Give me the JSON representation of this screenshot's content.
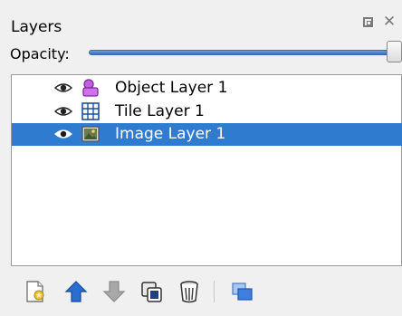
{
  "panel": {
    "title": "Layers"
  },
  "opacity": {
    "label": "Opacity:",
    "value": 1.0
  },
  "layers": [
    {
      "name": "Object Layer 1",
      "type": "object-layer-icon",
      "visible": true,
      "selected": false
    },
    {
      "name": "Tile Layer 1",
      "type": "tile-layer-icon",
      "visible": true,
      "selected": false
    },
    {
      "name": "Image Layer 1",
      "type": "image-layer-icon",
      "visible": true,
      "selected": true
    }
  ],
  "toolbar": {
    "buttons": [
      "new-layer-icon",
      "raise-layer-icon",
      "lower-layer-icon",
      "duplicate-layer-icon",
      "delete-layer-icon",
      "layer-properties-icon"
    ]
  },
  "colors": {
    "selection": "#2f7bd0",
    "accent": "#2f6fc0",
    "panel_bg": "#f0f0f0"
  }
}
